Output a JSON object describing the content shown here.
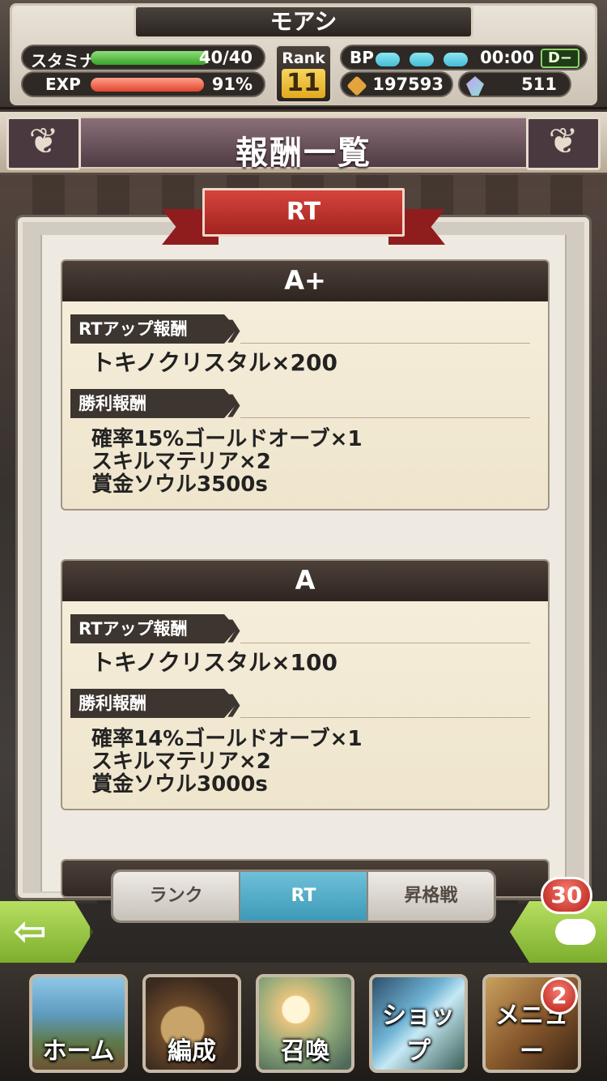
{
  "header": {
    "player_name": "モアシ",
    "stamina": {
      "label": "スタミナ",
      "value": "40/40",
      "fill": 1.0
    },
    "exp": {
      "label": "EXP",
      "value": "91%",
      "fill": 0.91
    },
    "rank": {
      "label": "Rank",
      "value": "11"
    },
    "bp": {
      "label": "BP",
      "timer": "00:00",
      "grade": "D−"
    },
    "gold": "197593",
    "crystals": "511"
  },
  "title": "報酬一覧",
  "ribbon": "RT",
  "cards": [
    {
      "grade": "A+",
      "rt_up_label": "RTアップ報酬",
      "rt_up_reward": "トキノクリスタル×200",
      "win_label": "勝利報酬",
      "win_rewards": [
        "確率15%ゴールドオーブ×1",
        "スキルマテリア×2",
        "賞金ソウル3500s"
      ]
    },
    {
      "grade": "A",
      "rt_up_label": "RTアップ報酬",
      "rt_up_reward": "トキノクリスタル×100",
      "win_label": "勝利報酬",
      "win_rewards": [
        "確率14%ゴールドオーブ×1",
        "スキルマテリア×2",
        "賞金ソウル3000s"
      ]
    }
  ],
  "tabs": [
    {
      "label": "ランク",
      "active": false
    },
    {
      "label": "RT",
      "active": true
    },
    {
      "label": "昇格戦",
      "active": false
    }
  ],
  "chat_count": "30",
  "nav": [
    {
      "label": "ホーム",
      "icon": "home-town-icon"
    },
    {
      "label": "編成",
      "icon": "formation-compass-icon"
    },
    {
      "label": "召喚",
      "icon": "summon-orb-icon"
    },
    {
      "label": "ショップ",
      "icon": "shop-crystal-icon"
    },
    {
      "label": "メニュー",
      "icon": "menu-book-icon",
      "badge": "2"
    }
  ],
  "colors": {
    "accent_red": "#c0302a",
    "active_tab": "#4fa8c4",
    "green": "#8ec23c"
  }
}
